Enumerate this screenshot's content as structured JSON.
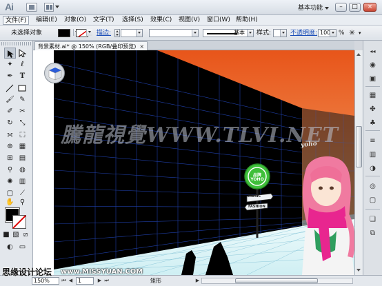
{
  "titlebar": {
    "logo": "Ai",
    "workspace": "基本功能",
    "minimize": "–",
    "maximize": "□",
    "close": "×"
  },
  "menu": [
    "文件(F)",
    "编辑(E)",
    "对象(O)",
    "文字(T)",
    "选择(S)",
    "效果(C)",
    "视图(V)",
    "窗口(W)",
    "帮助(H)"
  ],
  "control": {
    "selection_status": "未选择对象",
    "stroke_label": "描边:",
    "stroke_profile": "基本",
    "style_label": "样式:",
    "opacity_label": "不透明度:",
    "opacity_value": "100",
    "opacity_unit": "%"
  },
  "document": {
    "tab_title": "背景素材.ai* @ 150% (RGB/叠印预览)",
    "tab_close": "×"
  },
  "canvas": {
    "watermark": "騰龍視覺WWW.TLVI.NET",
    "sign_top": "品牌",
    "sign_bottom": "YOHO",
    "shop_text": "yoho",
    "arrow1": "MUSIC",
    "arrow2": "FASHION"
  },
  "status": {
    "zoom": "150%",
    "page": "1",
    "current_tool": "矩形"
  },
  "overlay": {
    "site_name": "思缘设计论坛",
    "site_url": "www.MISSYUAN.COM"
  },
  "colors": {
    "sky_top": "#e8551a",
    "sky_bottom": "#f4b87c",
    "wall": "#000000",
    "grid": "#1f3fa8",
    "floor": "#e6f6f8",
    "sign": "#3fbf3a"
  }
}
